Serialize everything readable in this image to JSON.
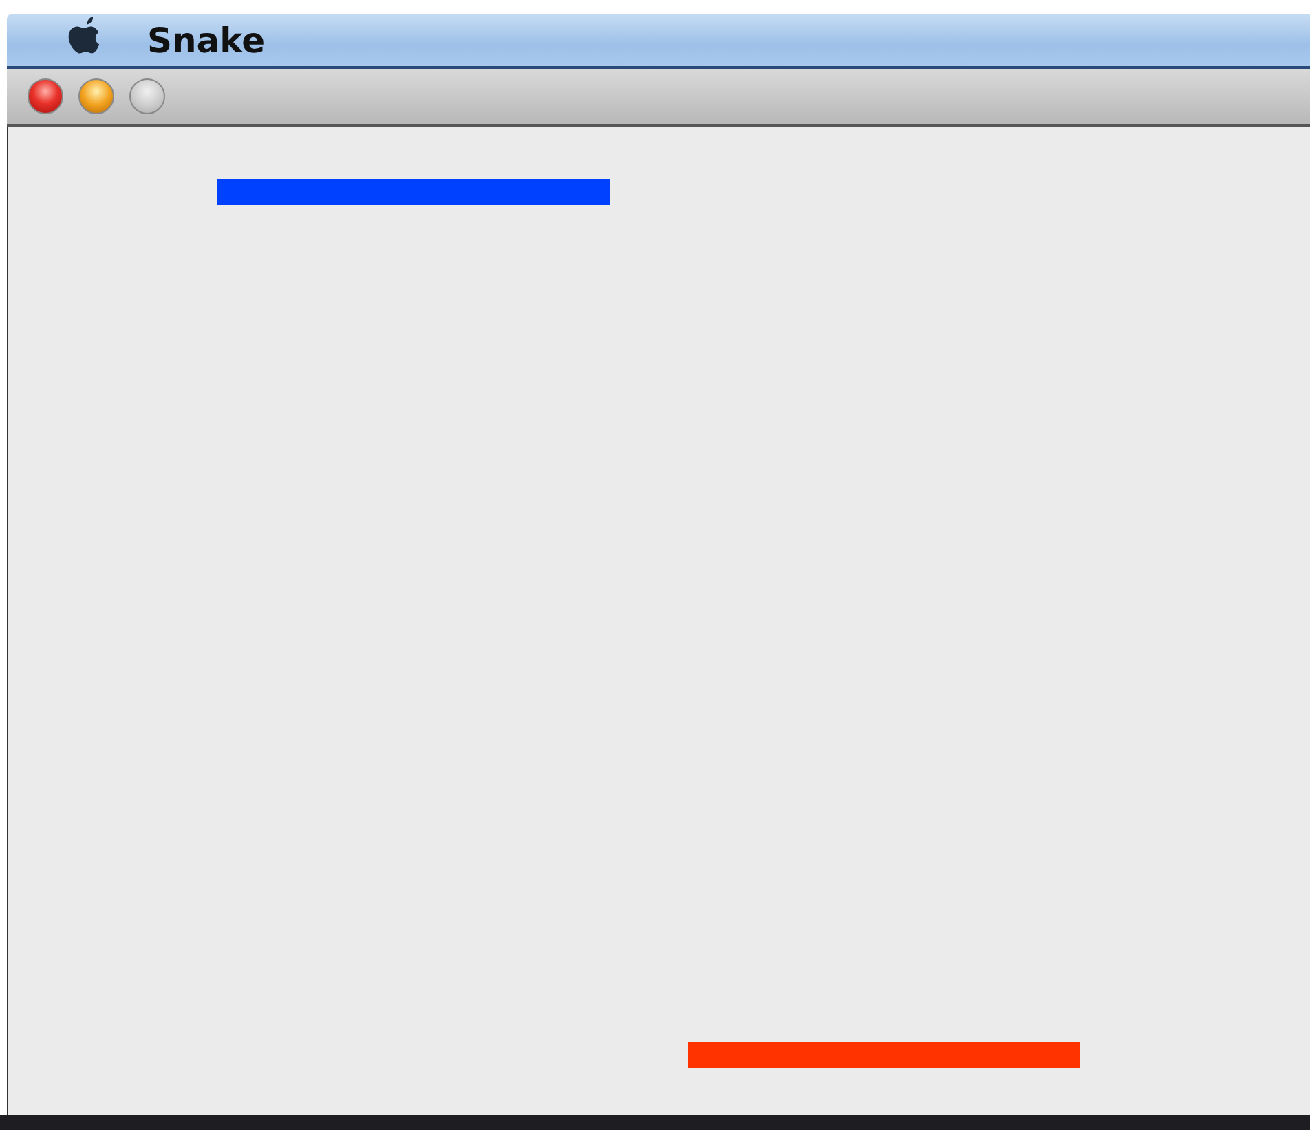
{
  "menu_bar": {
    "app_name": "Snake"
  },
  "window_buttons": [
    {
      "kind": "close",
      "disabled": false
    },
    {
      "kind": "minimize",
      "disabled": false
    },
    {
      "kind": "zoom",
      "disabled": true
    }
  ],
  "snakes": [
    {
      "color": "#0040ff"
    },
    {
      "color": "#ff3300"
    }
  ]
}
